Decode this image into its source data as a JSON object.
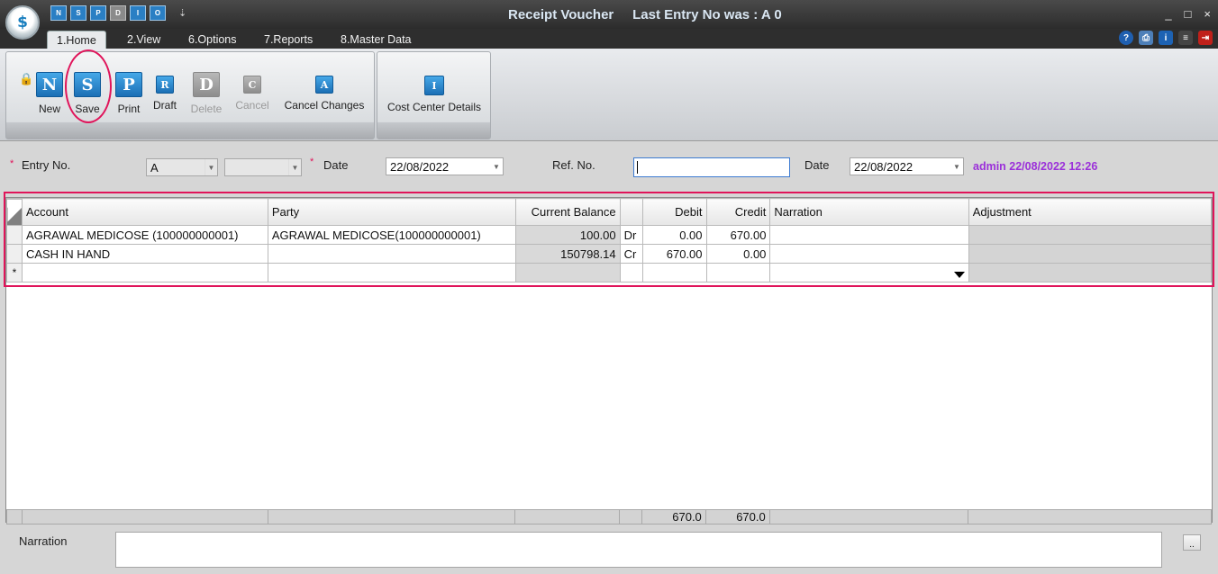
{
  "window": {
    "title": "Receipt Voucher",
    "last_entry": "Last Entry No was : A 0",
    "logo_glyph": "$",
    "controls": [
      "_",
      "□",
      "×"
    ]
  },
  "quick_access": [
    "N",
    "S",
    "P",
    "D",
    "I",
    "O"
  ],
  "quick_access_more": "⇣",
  "tabs": [
    {
      "label": "1.Home",
      "active": true
    },
    {
      "label": "2.View",
      "active": false
    },
    {
      "label": "6.Options",
      "active": false
    },
    {
      "label": "7.Reports",
      "active": false
    },
    {
      "label": "8.Master Data",
      "active": false
    }
  ],
  "help_icons": [
    {
      "name": "help-icon",
      "glyph": "?",
      "color": "#1f5fb0"
    },
    {
      "name": "printer-icon",
      "glyph": "⎙",
      "color": "#4d7fb8"
    },
    {
      "name": "info-icon",
      "glyph": "i",
      "color": "#1d62b3"
    },
    {
      "name": "notepad-icon",
      "glyph": "≡",
      "color": "#444444"
    },
    {
      "name": "exit-icon",
      "glyph": "⇥",
      "color": "#c0201a"
    }
  ],
  "ribbon": {
    "buttons": [
      {
        "label": "New",
        "glyph": "N",
        "enabled": true
      },
      {
        "label": "Save",
        "glyph": "S",
        "enabled": true
      },
      {
        "label": "Print",
        "glyph": "P",
        "enabled": true
      },
      {
        "label": "Draft",
        "glyph": "R",
        "enabled": true
      },
      {
        "label": "Delete",
        "glyph": "D",
        "enabled": false
      },
      {
        "label": "Cancel",
        "glyph": "C",
        "enabled": false
      },
      {
        "label": "Cancel Changes",
        "glyph": "A",
        "enabled": true
      }
    ],
    "cost_center": {
      "label": "Cost Center Details",
      "glyph": "I"
    }
  },
  "header": {
    "entry_no_label": "Entry No.",
    "entry_no_value": "A",
    "entry_no_sub": "",
    "date_label": "Date",
    "date_value": "22/08/2022",
    "ref_no_label": "Ref. No.",
    "ref_no_value": "",
    "ref_date_label": "Date",
    "ref_date_value": "22/08/2022",
    "audit": "admin 22/08/2022 12:26",
    "required_mark": "*"
  },
  "grid": {
    "columns": [
      "Account",
      "Party",
      "Current Balance",
      "",
      "Debit",
      "Credit",
      "Narration",
      "Adjustment"
    ],
    "rows": [
      {
        "account": "AGRAWAL MEDICOSE (100000000001)",
        "party": "AGRAWAL MEDICOSE(100000000001)",
        "balance": "100.00",
        "drcr": "Dr",
        "debit": "0.00",
        "credit": "670.00",
        "narration": "",
        "adjustment": ""
      },
      {
        "account": "CASH IN HAND",
        "party": "",
        "balance": "150798.14",
        "drcr": "Cr",
        "debit": "670.00",
        "credit": "0.00",
        "narration": "",
        "adjustment": ""
      }
    ],
    "new_row_marker": "*",
    "totals": {
      "debit": "670.0",
      "credit": "670.0"
    }
  },
  "footer": {
    "narration_label": "Narration",
    "narration_value": "",
    "more_button": ".."
  },
  "colors": {
    "highlight": "#e0145a",
    "audit": "#9b30d9",
    "accent": "#1b6fb5"
  }
}
